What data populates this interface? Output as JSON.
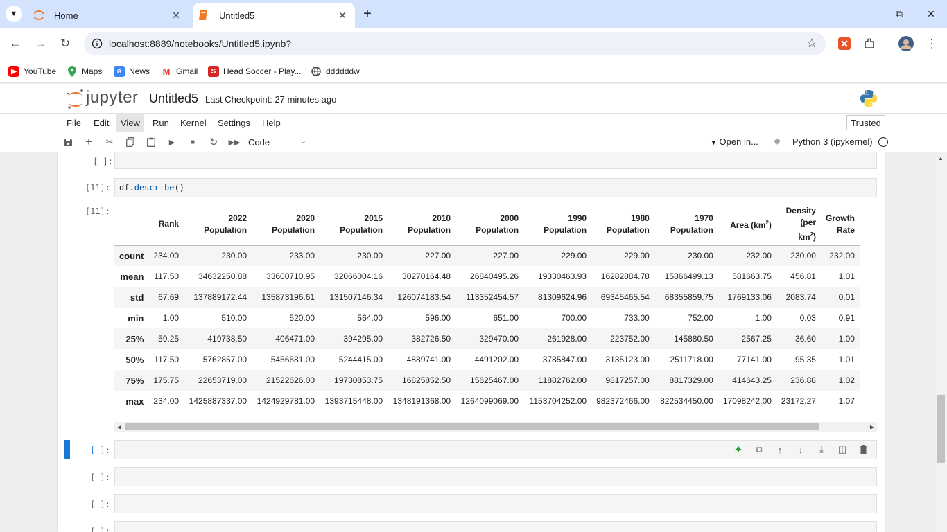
{
  "browser": {
    "tabs": [
      {
        "label": "Home",
        "active": false
      },
      {
        "label": "Untitled5",
        "active": true
      }
    ],
    "url": "localhost:8889/notebooks/Untitled5.ipynb?",
    "bookmarks": [
      {
        "label": "YouTube",
        "icon": "youtube-icon"
      },
      {
        "label": "Maps",
        "icon": "maps-icon"
      },
      {
        "label": "News",
        "icon": "news-icon"
      },
      {
        "label": "Gmail",
        "icon": "gmail-icon"
      },
      {
        "label": "Head Soccer - Play...",
        "icon": "head-soccer-icon"
      },
      {
        "label": "ddddddw",
        "icon": "globe-icon"
      }
    ]
  },
  "jupyter": {
    "logo_text": "jupyter",
    "notebook_title": "Untitled5",
    "checkpoint": "Last Checkpoint: 27 minutes ago",
    "menu": [
      "File",
      "Edit",
      "View",
      "Run",
      "Kernel",
      "Settings",
      "Help"
    ],
    "active_menu": "View",
    "trusted": "Trusted",
    "cell_type": "Code",
    "open_in": "Open in...",
    "kernel": "Python 3 (ipykernel)"
  },
  "cells": {
    "empty_prompt": "[ ]:",
    "run_prompt": "[11]:",
    "out_prompt": "[11]:",
    "code_obj": "df.",
    "code_fn": "describe",
    "code_tail": "()"
  },
  "table": {
    "columns": [
      "Rank",
      "2022 Population",
      "2020 Population",
      "2015 Population",
      "2010 Population",
      "2000 Population",
      "1990 Population",
      "1980 Population",
      "1970 Population",
      "Area (km²)",
      "Density (per km²)",
      "Growth Rate"
    ],
    "rows": [
      {
        "stat": "count",
        "values": [
          "234.00",
          "230.00",
          "233.00",
          "230.00",
          "227.00",
          "227.00",
          "229.00",
          "229.00",
          "230.00",
          "232.00",
          "230.00",
          "232.00"
        ]
      },
      {
        "stat": "mean",
        "values": [
          "117.50",
          "34632250.88",
          "33600710.95",
          "32066004.16",
          "30270164.48",
          "26840495.26",
          "19330463.93",
          "16282884.78",
          "15866499.13",
          "581663.75",
          "456.81",
          "1.01"
        ]
      },
      {
        "stat": "std",
        "values": [
          "67.69",
          "137889172.44",
          "135873196.61",
          "131507146.34",
          "126074183.54",
          "113352454.57",
          "81309624.96",
          "69345465.54",
          "68355859.75",
          "1769133.06",
          "2083.74",
          "0.01"
        ]
      },
      {
        "stat": "min",
        "values": [
          "1.00",
          "510.00",
          "520.00",
          "564.00",
          "596.00",
          "651.00",
          "700.00",
          "733.00",
          "752.00",
          "1.00",
          "0.03",
          "0.91"
        ]
      },
      {
        "stat": "25%",
        "values": [
          "59.25",
          "419738.50",
          "406471.00",
          "394295.00",
          "382726.50",
          "329470.00",
          "261928.00",
          "223752.00",
          "145880.50",
          "2567.25",
          "36.60",
          "1.00"
        ]
      },
      {
        "stat": "50%",
        "values": [
          "117.50",
          "5762857.00",
          "5456681.00",
          "5244415.00",
          "4889741.00",
          "4491202.00",
          "3785847.00",
          "3135123.00",
          "2511718.00",
          "77141.00",
          "95.35",
          "1.01"
        ]
      },
      {
        "stat": "75%",
        "values": [
          "175.75",
          "22653719.00",
          "21522626.00",
          "19730853.75",
          "16825852.50",
          "15625467.00",
          "11882762.00",
          "9817257.00",
          "8817329.00",
          "414643.25",
          "236.88",
          "1.02"
        ]
      },
      {
        "stat": "max",
        "values": [
          "234.00",
          "1425887337.00",
          "1424929781.00",
          "1393715448.00",
          "1348191368.00",
          "1264099069.00",
          "1153704252.00",
          "982372466.00",
          "822534450.00",
          "17098242.00",
          "23172.27",
          "1.07"
        ]
      }
    ]
  }
}
